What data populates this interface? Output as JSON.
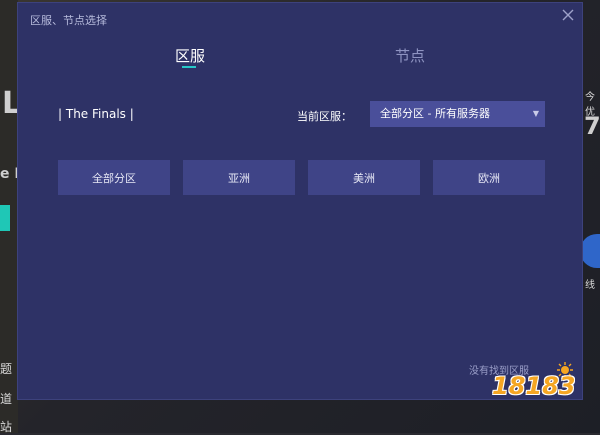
{
  "modal": {
    "title": "区服、节点选择",
    "tabs": [
      {
        "label": "区服",
        "active": true
      },
      {
        "label": "节点",
        "active": false
      }
    ],
    "game_name": "| The Finals |",
    "current_region_label": "当前区服：",
    "current_region_value": "全部分区 - 所有服务器",
    "region_buttons": [
      "全部分区",
      "亚洲",
      "美洲",
      "欧洲"
    ],
    "not_found_link": "没有找到区服"
  },
  "background": {
    "left_glyphs": [
      "L",
      "e F",
      "题",
      "道",
      "站"
    ],
    "right_glyphs": [
      "今优",
      "7",
      "线"
    ]
  },
  "watermark": {
    "text": "18183"
  },
  "colors": {
    "modal_bg": "#2e3266",
    "button_bg": "#3f4487",
    "select_bg": "#4a4f9a",
    "accent": "#28c8c8",
    "watermark": "#f5a623"
  },
  "icons": {
    "close": "close-icon",
    "dropdown": "caret-down-icon"
  }
}
